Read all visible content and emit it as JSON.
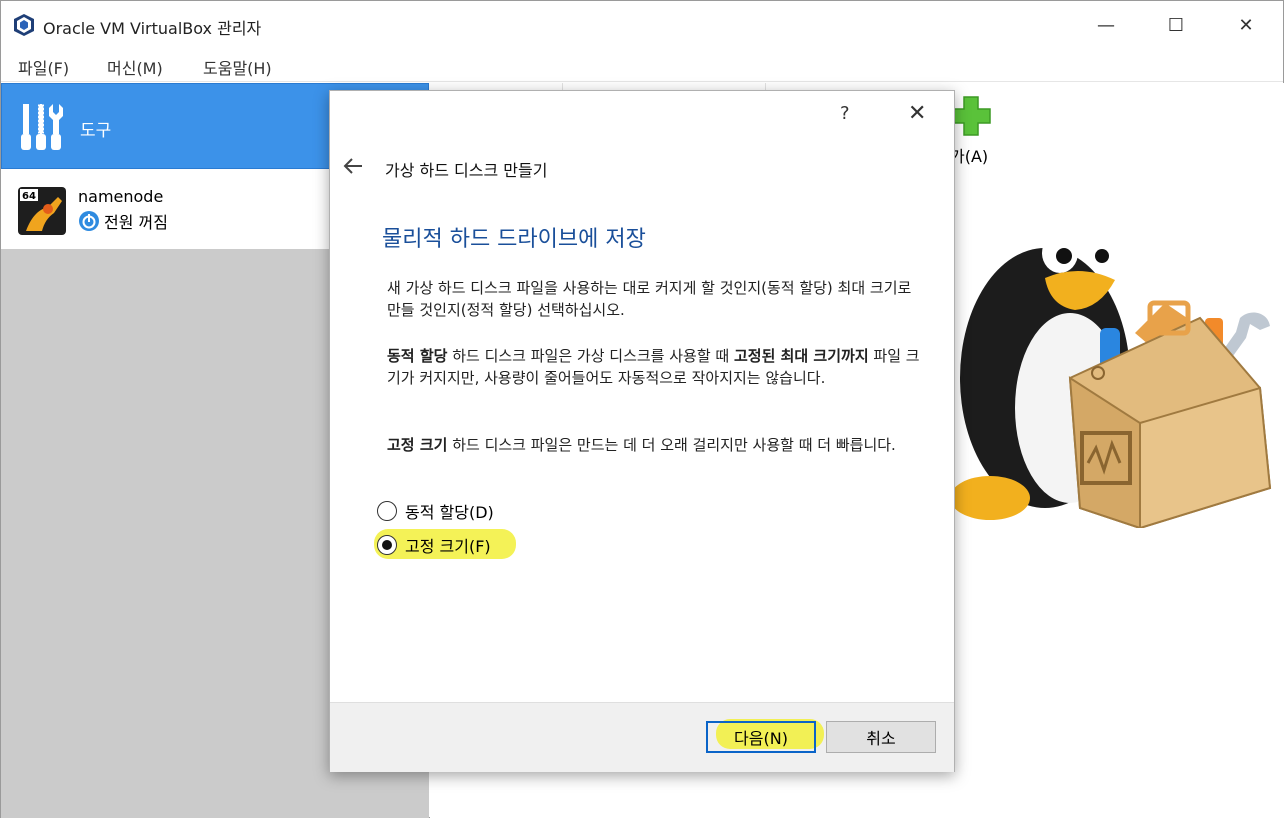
{
  "window": {
    "title": "Oracle VM VirtualBox 관리자",
    "controls": {
      "minimize": "—",
      "maximize": "☐",
      "close": "✕"
    }
  },
  "menubar": {
    "items": [
      {
        "label": "파일(F)"
      },
      {
        "label": "머신(M)"
      },
      {
        "label": "도움말(H)"
      }
    ]
  },
  "sidebar": {
    "tools_label": "도구",
    "vm": {
      "name": "namenode",
      "state": "전원 꺼짐",
      "badge": "64"
    }
  },
  "toolbar": {
    "add_label": "가(A)"
  },
  "dialog": {
    "help": "?",
    "close": "✕",
    "title": "가상 하드 디스크 만들기",
    "heading": "물리적 하드 드라이브에 저장",
    "para1": "새 가상 하드 디스크 파일을 사용하는 대로 커지게 할 것인지(동적 할당) 최대 크기로 만들 것인지(정적 할당) 선택하십시오.",
    "para2": {
      "bold1": "동적 할당",
      "text1": " 하드 디스크 파일은 가상 디스크를 사용할 때 ",
      "bold2": "고정된 최대 크기까지",
      "text2": " 파일 크기가 커지지만, 사용량이 줄어들어도 자동적으로 작아지지는 않습니다."
    },
    "para3": {
      "bold1": "고정 크기",
      "text1": " 하드 디스크 파일은 만드는 데 더 오래 걸리지만 사용할 때 더 빠릅니다."
    },
    "options": [
      {
        "label": "동적 할당(D)",
        "selected": false
      },
      {
        "label": "고정 크기(F)",
        "selected": true
      }
    ],
    "buttons": {
      "next": "다음(N)",
      "cancel": "취소"
    }
  },
  "colors": {
    "accent": "#3c92e9",
    "heading": "#1a4f9a",
    "highlight": "#f2f03a"
  }
}
